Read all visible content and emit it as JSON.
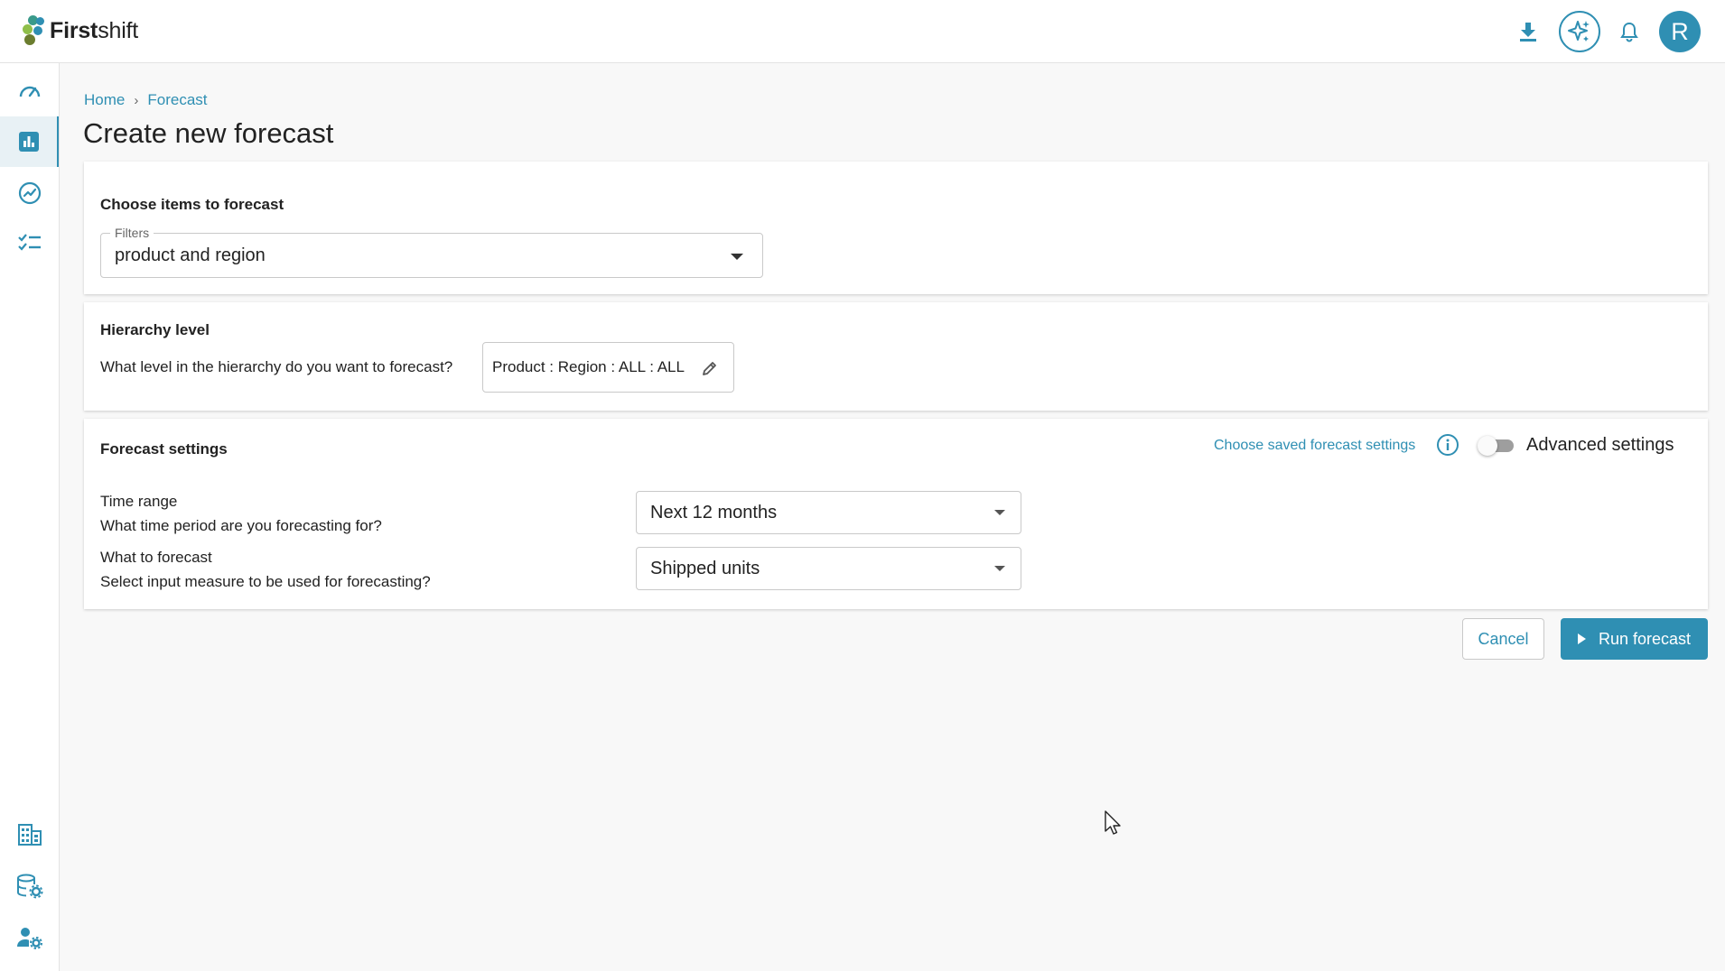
{
  "app": {
    "logo_text_bold": "First",
    "logo_text_regular": "shift",
    "brand_color": "#2f8fb3",
    "logo_dot_colors": [
      "#2f8fb3",
      "#8fbf4a",
      "#6b7d2f",
      "#3a9a8a"
    ]
  },
  "topbar": {
    "icons": [
      "download-icon",
      "ai-sparkle-icon",
      "bell-icon"
    ],
    "avatar_initial": "R"
  },
  "sidebar": {
    "items": [
      {
        "name": "dashboard-icon",
        "active": false
      },
      {
        "name": "bar-chart-icon",
        "active": true
      },
      {
        "name": "trend-icon",
        "active": false
      },
      {
        "name": "checklist-icon",
        "active": false
      }
    ],
    "bottom_items": [
      "building-icon",
      "database-settings-icon",
      "user-settings-icon"
    ]
  },
  "breadcrumb": {
    "home": "Home",
    "separator": "›",
    "current": "Forecast"
  },
  "page_title": "Create new forecast",
  "items_card": {
    "title": "Choose items to forecast",
    "filter_label": "Filters",
    "filter_value": "product and region"
  },
  "hierarchy_card": {
    "title": "Hierarchy level",
    "question": "What level in the hierarchy do you want to forecast?",
    "value": "Product : Region : ALL : ALL"
  },
  "settings_card": {
    "title": "Forecast settings",
    "saved_settings_link": "Choose saved forecast settings",
    "advanced_label": "Advanced settings",
    "advanced_enabled": false,
    "time_range_label": "Time range",
    "time_range_question": "What time period are you forecasting for?",
    "time_range_value": "Next 12 months",
    "measure_label": "What to forecast",
    "measure_question": "Select input measure to be used for forecasting?",
    "measure_value": "Shipped units"
  },
  "actions": {
    "cancel": "Cancel",
    "run": "Run forecast"
  }
}
